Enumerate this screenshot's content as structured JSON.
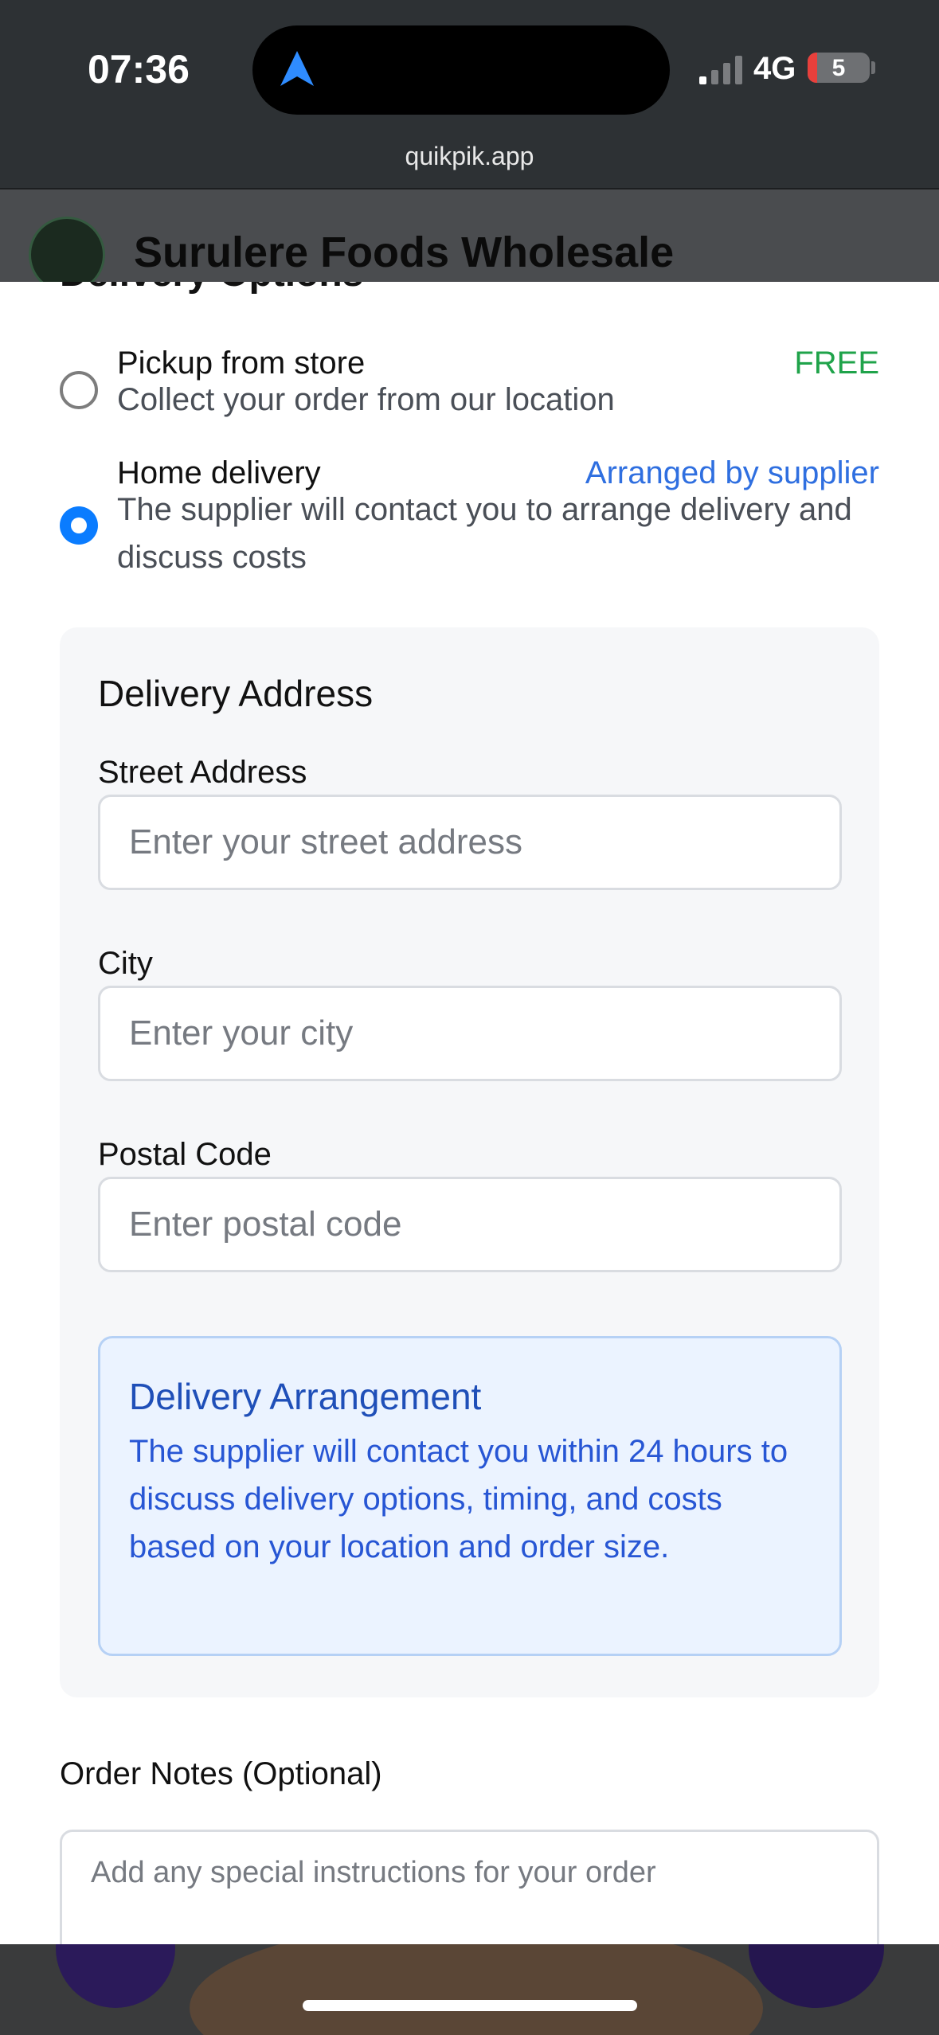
{
  "status_bar": {
    "time": "07:36",
    "network": "4G",
    "battery": "5",
    "battery_level": 0.05,
    "battery_color": "#e8403c"
  },
  "browser": {
    "url": "quikpik.app"
  },
  "store": {
    "name": "Surulere Foods Wholesale"
  },
  "delivery": {
    "section_title": "Delivery Options",
    "options": [
      {
        "title": "Pickup from store",
        "description": "Collect your order from our location",
        "price": "FREE",
        "price_color": "#1fa34a",
        "selected": false
      },
      {
        "title": "Home delivery",
        "description": "The supplier will contact you to arrange delivery and discuss costs",
        "price": "Arranged by supplier",
        "price_color": "#2f6fe0",
        "selected": true
      }
    ]
  },
  "address": {
    "title": "Delivery Address",
    "street_label": "Street Address",
    "street_placeholder": "Enter your street address",
    "city_label": "City",
    "city_placeholder": "Enter your city",
    "postal_label": "Postal Code",
    "postal_placeholder": "Enter postal code"
  },
  "arrangement": {
    "title": "Delivery Arrangement",
    "text": "The supplier will contact you within 24 hours to discuss delivery options, timing, and costs based on your location and order size."
  },
  "notes": {
    "label": "Order Notes (Optional)",
    "placeholder": "Add any special instructions for your order"
  },
  "colors": {
    "accent_blue": "#0a7cff",
    "free_green": "#1fa34a",
    "info_blue": "#2756d4"
  },
  "icons": {
    "navigation": "location-arrow-icon",
    "signal": "cellular-signal-icon",
    "battery": "battery-icon",
    "radio_selected": "radio-selected-icon",
    "radio_unselected": "radio-unselected-icon"
  }
}
